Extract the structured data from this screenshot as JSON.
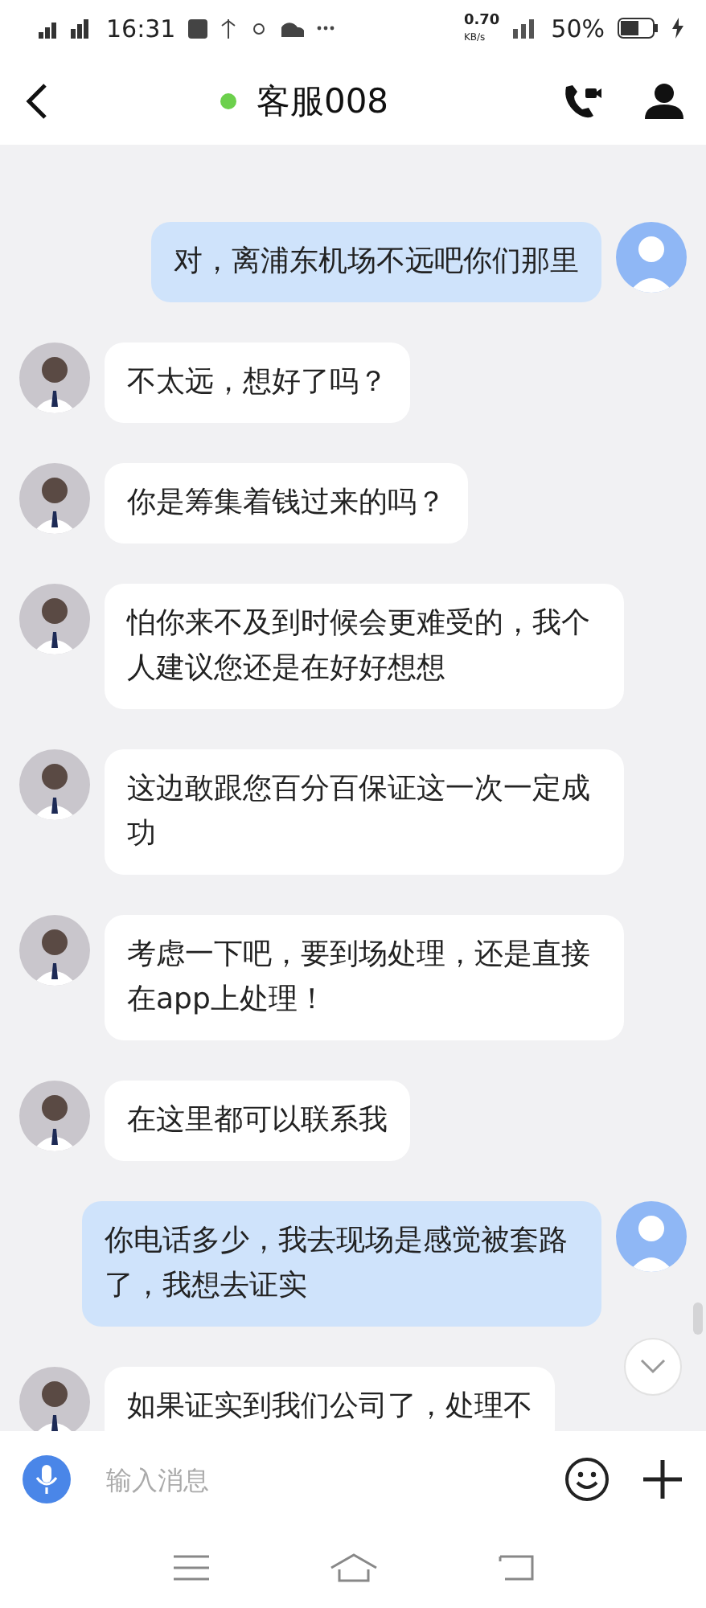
{
  "status_bar": {
    "time": "16:31",
    "net_speed": "0.70",
    "net_unit": "KB/s",
    "battery": "50%"
  },
  "header": {
    "title": "客服008",
    "online": true
  },
  "messages": [
    {
      "kind": "outgoing",
      "text": "对，离浦东机场不远吧你们那里"
    },
    {
      "kind": "incoming",
      "text": "不太远，想好了吗？"
    },
    {
      "kind": "incoming",
      "text": "你是筹集着钱过来的吗？"
    },
    {
      "kind": "incoming",
      "text": "怕你来不及到时候会更难受的，我个人建议您还是在好好想想"
    },
    {
      "kind": "incoming",
      "text": "这边敢跟您百分百保证这一次一定成功"
    },
    {
      "kind": "incoming",
      "text": "考虑一下吧，要到场处理，还是直接在app上处理！"
    },
    {
      "kind": "incoming",
      "text": "在这里都可以联系我"
    },
    {
      "kind": "outgoing",
      "text": "你电话多少，我去现场是感觉被套路了，我想去证实"
    },
    {
      "kind": "incoming",
      "text": "如果证实到我们公司了，处理不"
    }
  ],
  "composer": {
    "placeholder": "输入消息"
  }
}
